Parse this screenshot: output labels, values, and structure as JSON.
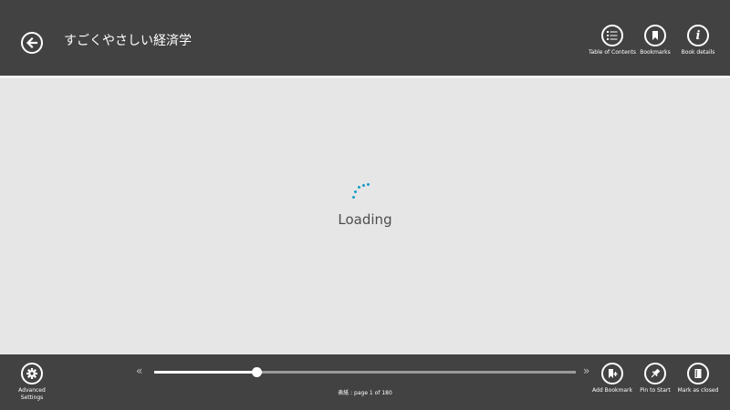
{
  "header": {
    "title": "すごくやさしい経済学",
    "buttons": [
      {
        "icon": "list-icon",
        "label": "Table of Contents"
      },
      {
        "icon": "bookmark-icon",
        "label": "Bookmarks"
      },
      {
        "icon": "info-icon",
        "label": "Book details"
      }
    ]
  },
  "main": {
    "loading_text": "Loading",
    "accent_color": "#1a9dc5"
  },
  "footer": {
    "advanced_settings_label": "Advanced Settings",
    "page_info": "表紙 : page 1 of 180",
    "progress": 0.242,
    "prev_icon": "«",
    "next_icon": "»",
    "buttons": [
      {
        "icon": "add-bookmark-icon",
        "label": "Add Bookmark"
      },
      {
        "icon": "pin-icon",
        "label": "Pin to Start"
      },
      {
        "icon": "book-icon",
        "label": "Mark as closed"
      }
    ]
  }
}
